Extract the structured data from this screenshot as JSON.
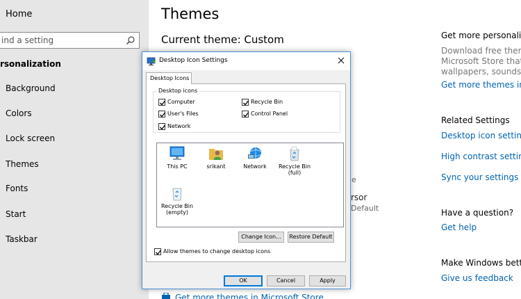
{
  "sidebar": {
    "home": "Home",
    "search_placeholder": "ind a setting",
    "section": "rsonalization",
    "items": [
      "Background",
      "Colors",
      "Lock screen",
      "Themes",
      "Fonts",
      "Start",
      "Taskbar"
    ]
  },
  "main": {
    "title": "Themes",
    "current_theme": "Current theme: Custom",
    "fragments": [
      "e",
      "rsor",
      "Default"
    ],
    "store_link": "Get more themes in Microsoft Store"
  },
  "right": {
    "personality_heading": "Get more personality i",
    "personality_text": [
      "Download free themes",
      "Microsoft Store that co",
      "wallpapers, sounds, and"
    ],
    "personality_link": "Get more themes in the",
    "related_heading": "Related Settings",
    "related_links": [
      "Desktop icon settings",
      "High contrast settings",
      "Sync your settings"
    ],
    "question_heading": "Have a question?",
    "help_link": "Get help",
    "better_heading": "Make Windows better",
    "feedback_link": "Give us feedback"
  },
  "dialog": {
    "title": "Desktop Icon Settings",
    "tab": "Desktop Icons",
    "group_label": "Desktop icons",
    "checkboxes": [
      {
        "label": "Computer",
        "checked": true
      },
      {
        "label": "Recycle Bin",
        "checked": true
      },
      {
        "label": "User's Files",
        "checked": true
      },
      {
        "label": "Control Panel",
        "checked": true
      },
      {
        "label": "Network",
        "checked": true
      }
    ],
    "icons": [
      "This PC",
      "srikant",
      "Network",
      "Recycle Bin\n(full)",
      "Recycle Bin\n(empty)"
    ],
    "change_icon": "Change Icon...",
    "restore_default": "Restore Default",
    "allow_themes": "Allow themes to change desktop icons",
    "allow_themes_checked": true,
    "ok": "OK",
    "cancel": "Cancel",
    "apply": "Apply"
  },
  "colors": {
    "accent": "#0063b1",
    "sidebar_bg": "#e6e6e6",
    "dialog_bg": "#f0f0f0"
  }
}
